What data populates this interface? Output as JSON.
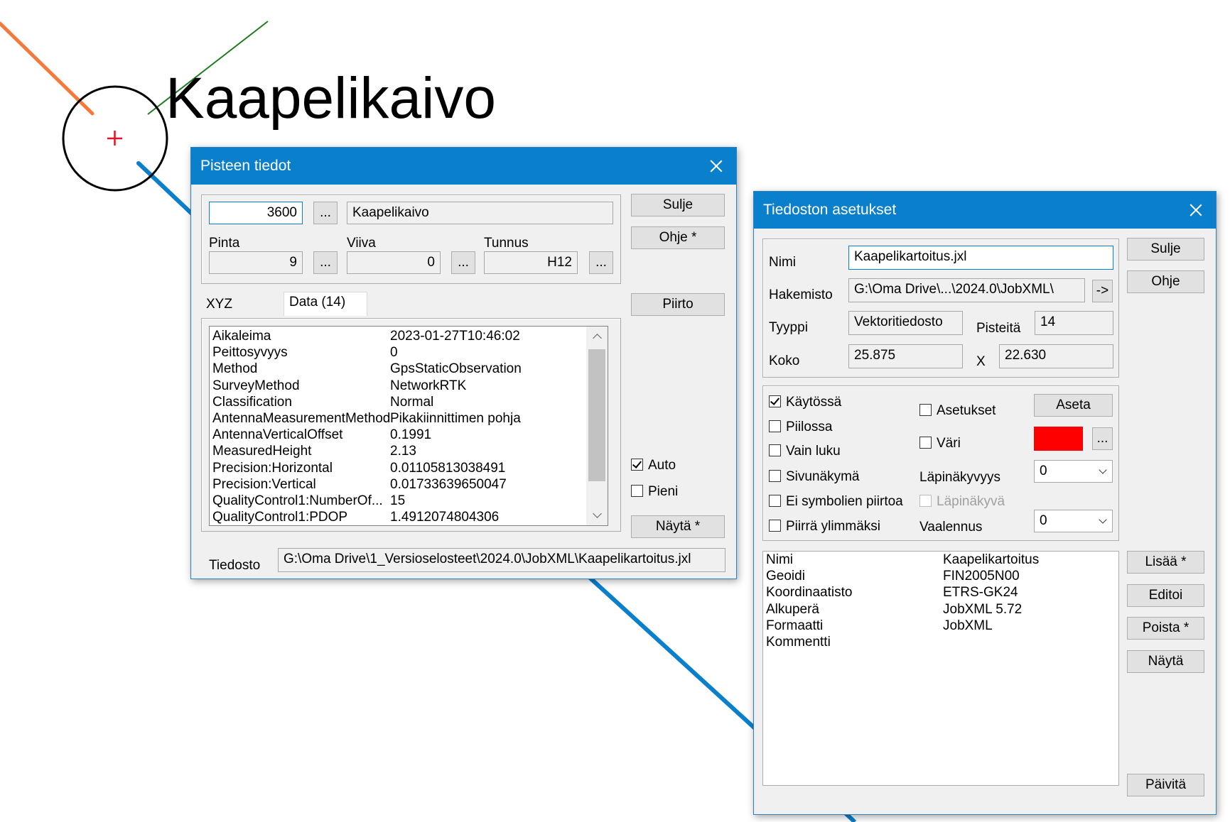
{
  "map": {
    "label": "Kaapelikaivo",
    "colors": {
      "orange_line": "#f4793b",
      "green_line": "#1f7a1f",
      "blue_line": "#0a7fcc",
      "marker_cross": "#e81123"
    }
  },
  "point_dialog": {
    "title": "Pisteen tiedot",
    "point_number": "3600",
    "point_name": "Kaapelikaivo",
    "pinta_label": "Pinta",
    "pinta_value": "9",
    "viiva_label": "Viiva",
    "viiva_value": "0",
    "tunnus_label": "Tunnus",
    "tunnus_value": "H12",
    "browse_label": "...",
    "buttons": {
      "sulje": "Sulje",
      "ohje": "Ohje *",
      "piirto": "Piirto",
      "nayta": "Näytä *"
    },
    "tabs": {
      "xyz": "XYZ",
      "data": "Data (14)"
    },
    "data_rows": [
      {
        "key": "Aikaleima",
        "value": "2023-01-27T10:46:02"
      },
      {
        "key": "Peittosyvyys",
        "value": "0"
      },
      {
        "key": "Method",
        "value": "GpsStaticObservation"
      },
      {
        "key": "SurveyMethod",
        "value": "NetworkRTK"
      },
      {
        "key": "Classification",
        "value": "Normal"
      },
      {
        "key": "AntennaMeasurementMethod",
        "value": "Pikakiinnittimen pohja"
      },
      {
        "key": "AntennaVerticalOffset",
        "value": "0.1991"
      },
      {
        "key": "MeasuredHeight",
        "value": "2.13"
      },
      {
        "key": "Precision:Horizontal",
        "value": "0.01105813038491"
      },
      {
        "key": "Precision:Vertical",
        "value": "0.01733639650047"
      },
      {
        "key": "QualityControl1:NumberOf...",
        "value": "15"
      },
      {
        "key": "QualityControl1:PDOP",
        "value": "1.4912074804306"
      }
    ],
    "auto_label": "Auto",
    "auto_checked": true,
    "pieni_label": "Pieni",
    "pieni_checked": false,
    "tiedosto_label": "Tiedosto",
    "tiedosto_value": "G:\\Oma Drive\\1_Versioselosteet\\2024.0\\JobXML\\Kaapelikartoitus.jxl"
  },
  "file_dialog": {
    "title": "Tiedoston asetukset",
    "nimi_label": "Nimi",
    "nimi_value": "Kaapelikartoitus.jxl",
    "hakemisto_label": "Hakemisto",
    "hakemisto_value": "G:\\Oma Drive\\...\\2024.0\\JobXML\\",
    "hakemisto_button": "->",
    "tyyppi_label": "Tyyppi",
    "tyyppi_value": "Vektoritiedosto",
    "pisteita_label": "Pisteitä",
    "pisteita_value": "14",
    "koko_label": "Koko",
    "koko_value": "25.875",
    "x_label": "X",
    "x_value": "22.630",
    "buttons": {
      "sulje": "Sulje",
      "ohje": "Ohje",
      "aseta": "Aseta",
      "browse": "...",
      "lisaa": "Lisää *",
      "editoi": "Editoi",
      "poista": "Poista *",
      "nayta": "Näytä",
      "paivita": "Päivitä"
    },
    "options": {
      "kaytossa": {
        "label": "Käytössä",
        "checked": true
      },
      "piilossa": {
        "label": "Piilossa",
        "checked": false
      },
      "vain_luku": {
        "label": "Vain luku",
        "checked": false
      },
      "sivunakyma": {
        "label": "Sivunäkymä",
        "checked": false
      },
      "ei_symbolien_piirtoa": {
        "label": "Ei symbolien piirtoa",
        "checked": false
      },
      "piirra_ylimmaksi": {
        "label": "Piirrä ylimmäksi",
        "checked": false
      },
      "asetukset": {
        "label": "Asetukset",
        "checked": false
      },
      "vari": {
        "label": "Väri",
        "checked": false
      },
      "lapinakyva": {
        "label": "Läpinäkyvä",
        "checked": false,
        "disabled": true
      }
    },
    "color_value": "#ff0000",
    "lapinakyvyys_label": "Läpinäkyvyys",
    "lapinakyvyys_value": "0",
    "vaalennus_label": "Vaalennus",
    "vaalennus_value": "0",
    "info_rows": [
      {
        "key": "Nimi",
        "value": "Kaapelikartoitus"
      },
      {
        "key": "Geoidi",
        "value": "FIN2005N00"
      },
      {
        "key": "Koordinaatisto",
        "value": "ETRS-GK24"
      },
      {
        "key": "Alkuperä",
        "value": "JobXML 5.72"
      },
      {
        "key": "Formaatti",
        "value": "JobXML"
      },
      {
        "key": "Kommentti",
        "value": ""
      }
    ]
  }
}
